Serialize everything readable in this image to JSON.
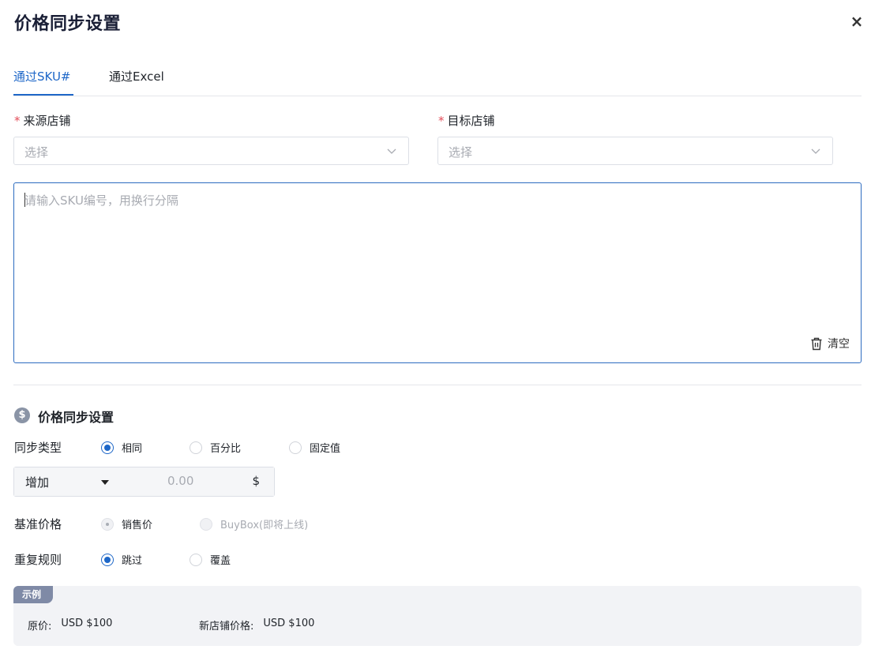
{
  "dialog": {
    "title": "价格同步设置",
    "close_label": "×"
  },
  "tabs": [
    {
      "label": "通过SKU#",
      "active": true
    },
    {
      "label": "通过Excel",
      "active": false
    }
  ],
  "source_store": {
    "required_mark": "*",
    "label": "来源店铺",
    "placeholder": "选择"
  },
  "target_store": {
    "required_mark": "*",
    "label": "目标店铺",
    "placeholder": "选择"
  },
  "sku_input": {
    "placeholder": "请输入SKU编号，用换行分隔",
    "clear_label": "清空"
  },
  "price_section": {
    "icon": "dollar-icon",
    "icon_glyph": "$",
    "title": "价格同步设置",
    "sync_type": {
      "label": "同步类型",
      "options": [
        {
          "label": "相同",
          "checked": true
        },
        {
          "label": "百分比",
          "checked": false
        },
        {
          "label": "固定值",
          "checked": false
        }
      ]
    },
    "adjust": {
      "mode": "增加",
      "placeholder": "0.00",
      "unit": "$"
    },
    "base_price": {
      "label": "基准价格",
      "options": [
        {
          "label": "销售价",
          "checked": true,
          "disabled": true
        },
        {
          "label": "BuyBox(即将上线)",
          "checked": false,
          "disabled": true
        }
      ]
    },
    "duplicate_rule": {
      "label": "重复规则",
      "options": [
        {
          "label": "跳过",
          "checked": true
        },
        {
          "label": "覆盖",
          "checked": false
        }
      ]
    }
  },
  "example": {
    "tag": "示例",
    "original_label": "原价:",
    "original_value": "USD $100",
    "new_label": "新店铺价格:",
    "new_value": "USD $100"
  },
  "colors": {
    "accent": "#1e67c8",
    "required": "#e34d59",
    "example_tag": "#7f8aa6"
  }
}
